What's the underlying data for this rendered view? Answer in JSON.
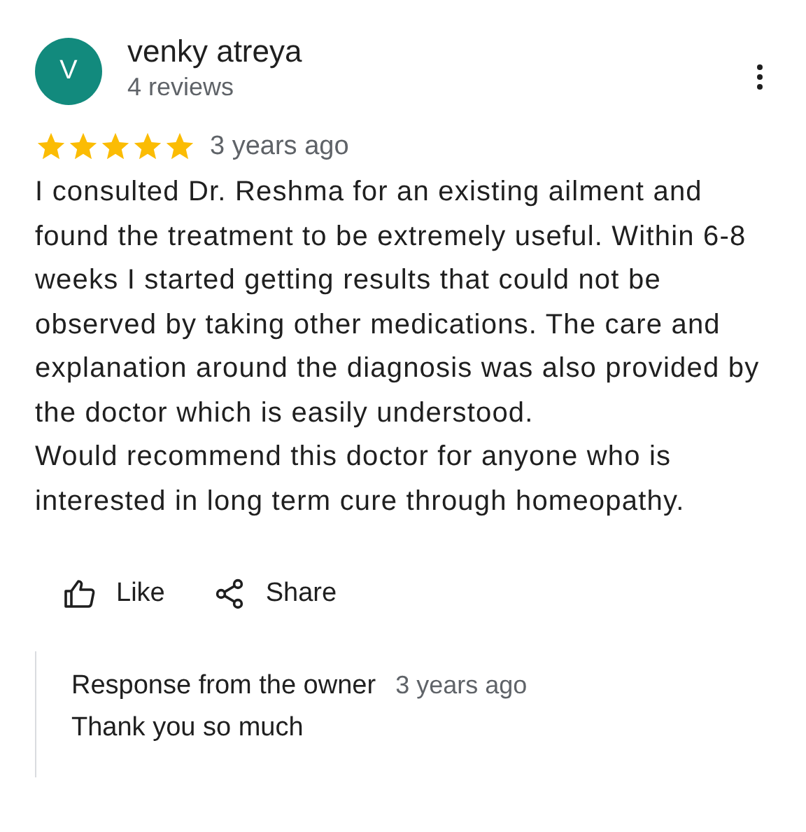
{
  "review": {
    "avatar_letter": "V",
    "author": "venky atreya",
    "review_count": "4 reviews",
    "stars": 5,
    "time": "3 years ago",
    "paragraphs": [
      "I consulted Dr. Reshma for an existing ailment and found the treatment to be extremely useful. Within 6-8 weeks I started getting results that could not be observed by taking other medications. The care and explanation around the diagnosis was also provided by the doctor which is easily understood.",
      "Would recommend this doctor for anyone who is interested in long term cure through homeopathy."
    ],
    "actions": [
      {
        "kind": "like",
        "label": "Like"
      },
      {
        "kind": "share",
        "label": "Share"
      }
    ],
    "owner_response": {
      "title": "Response from the owner",
      "time": "3 years ago",
      "text": "Thank you so much"
    }
  }
}
